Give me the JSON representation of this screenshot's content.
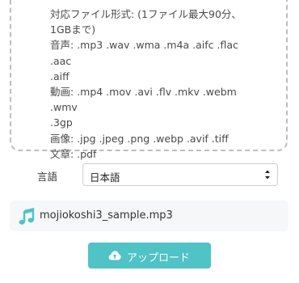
{
  "upload_area": {
    "formats_lines": [
      "対応ファイル形式: (1ファイル最大90分、",
      "1GBまで)",
      "音声: .mp3 .wav .wma .m4a .aifc .flac .aac",
      ".aiff",
      "動画: .mp4 .mov .avi .flv .mkv .webm .wmv",
      ".3gp",
      "画像: .jpg .jpeg .png .webp .avif .tiff",
      "文章: .pdf"
    ]
  },
  "language": {
    "label": "言語",
    "selected": "日本語"
  },
  "file": {
    "name": "mojiokoshi3_sample.mp3",
    "icon": "music-note-icon"
  },
  "upload_button": {
    "label": "アップロード",
    "icon": "cloud-upload-icon",
    "color": "#4fc3c6"
  }
}
